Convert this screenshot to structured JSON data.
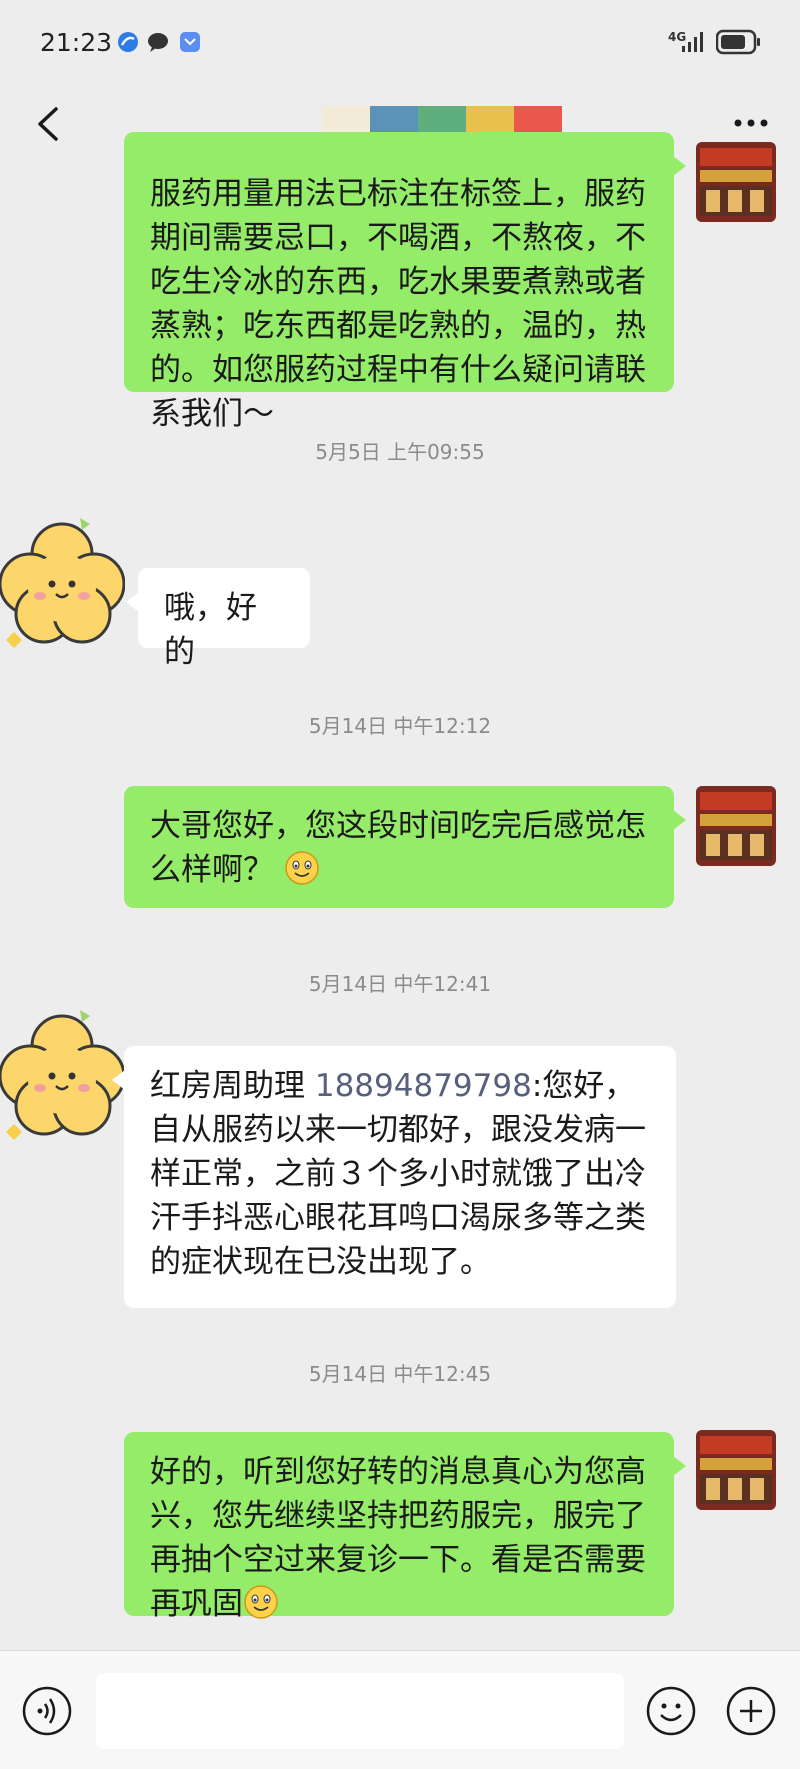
{
  "status_bar": {
    "time": "21:23",
    "network": "4G"
  },
  "header": {
    "title_blocks": [
      "#f3ead8",
      "#5b93b8",
      "#5fae7e",
      "#e8c24d",
      "#e9574d"
    ]
  },
  "messages": [
    {
      "side": "right",
      "text": "服药用量用法已标注在标签上，服药期间需要忌口，不喝酒，不熬夜，不吃生冷冰的东西，吃水果要煮熟或者蒸熟；吃东西都是吃熟的，温的，热的。如您服药过程中有什么疑问请联系我们～"
    },
    {
      "timestamp": "5月5日 上午09:55"
    },
    {
      "side": "left",
      "text": "哦，好的"
    },
    {
      "timestamp": "5月14日 中午12:12"
    },
    {
      "side": "right",
      "text": "大哥您好，您这段时间吃完后感觉怎么样啊？",
      "emoji": "smile-emoji"
    },
    {
      "timestamp": "5月14日 中午12:41"
    },
    {
      "side": "left",
      "prefix": "红房周助理 ",
      "phone": "18894879798",
      "text": ":您好，自从服药以来一切都好，跟没发病一样正常，之前３个多小时就饿了出冷汗手抖恶心眼花耳鸣口渴尿多等之类的症状现在已没出现了。"
    },
    {
      "timestamp": "5月14日 中午12:45"
    },
    {
      "side": "right",
      "text": "好的，听到您好转的消息真心为您高兴，您先继续坚持把药服完，服完了再抽个空过来复诊一下。看是否需要再巩固",
      "emoji": "smile-emoji"
    }
  ],
  "colors": {
    "bubble_green": "#95ec69",
    "bubble_white": "#ffffff",
    "background": "#ededed"
  },
  "icons": [
    "back-arrow-icon",
    "more-icon",
    "voice-icon",
    "emoji-icon",
    "plus-icon"
  ]
}
